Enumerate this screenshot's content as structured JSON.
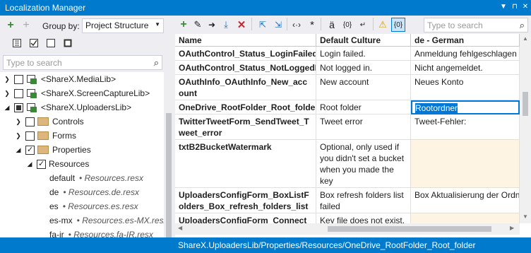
{
  "app": {
    "title": "Localization Manager"
  },
  "left_toolbar": {
    "group_by_label": "Group by:",
    "group_by_value": "Project Structure"
  },
  "left_search": {
    "placeholder": "Type to search"
  },
  "tree": [
    {
      "label": "<ShareX.MediaLib>",
      "expanded": false,
      "checked": "none"
    },
    {
      "label": "<ShareX.ScreenCaptureLib>",
      "expanded": false,
      "checked": "none"
    },
    {
      "label": "<ShareX.UploadersLib>",
      "expanded": true,
      "checked": "partial"
    },
    {
      "label": "Controls",
      "expanded": false,
      "checked": "none"
    },
    {
      "label": "Forms",
      "expanded": false,
      "checked": "none"
    },
    {
      "label": "Properties",
      "expanded": true,
      "checked": "checked"
    },
    {
      "label": "Resources",
      "expanded": true,
      "checked": "checked"
    },
    {
      "culture": "default",
      "file": "Resources.resx"
    },
    {
      "culture": "de",
      "file": "Resources.de.resx"
    },
    {
      "culture": "es",
      "file": "Resources.es.resx"
    },
    {
      "culture": "es-mx",
      "file": "Resources.es-MX.resx"
    },
    {
      "culture": "fa-ir",
      "file": "Resources.fa-IR.resx"
    }
  ],
  "right_search": {
    "placeholder": "Type to search"
  },
  "grid": {
    "columns": [
      "Name",
      "Default Culture",
      "de - German"
    ],
    "rows": [
      {
        "name": "OAuthControl_Status_LoginFailed",
        "default": "Login failed.",
        "de": "Anmeldung fehlgeschlagen"
      },
      {
        "name": "OAuthControl_Status_NotLoggedIn",
        "default": "Not logged in.",
        "de": "Nicht angemeldet."
      },
      {
        "name": "OAuthInfo_OAuthInfo_New_account",
        "default": "New account",
        "de": "Neues Konto"
      },
      {
        "name": "OneDrive_RootFolder_Root_folder",
        "default": "Root folder",
        "de": "Rootordner"
      },
      {
        "name": "TwitterTweetForm_SendTweet_Tweet_error",
        "default": "Tweet error",
        "de": "Tweet-Fehler:"
      },
      {
        "name": "txtB2BucketWatermark",
        "default": "Optional, only used if you didn't set a bucket when you made the key",
        "de": ""
      },
      {
        "name": "UploadersConfigForm_BoxListFolders_Box_refresh_folders_list_failed",
        "default": "Box refresh folders list failed",
        "de": "Box Aktualisierung der Ordn"
      },
      {
        "name": "UploadersConfigForm_ConnectSFTPAccount_Key_file_not_found",
        "default": "Key file does not exist.",
        "de": ""
      }
    ]
  },
  "status": {
    "path": "ShareX.UploadersLib/Properties/Resources/OneDrive_RootFolder_Root_folder"
  },
  "colors": {
    "accent": "#007acc",
    "selection_border": "#0078d7",
    "missing_translation": "#fdf4e3"
  }
}
